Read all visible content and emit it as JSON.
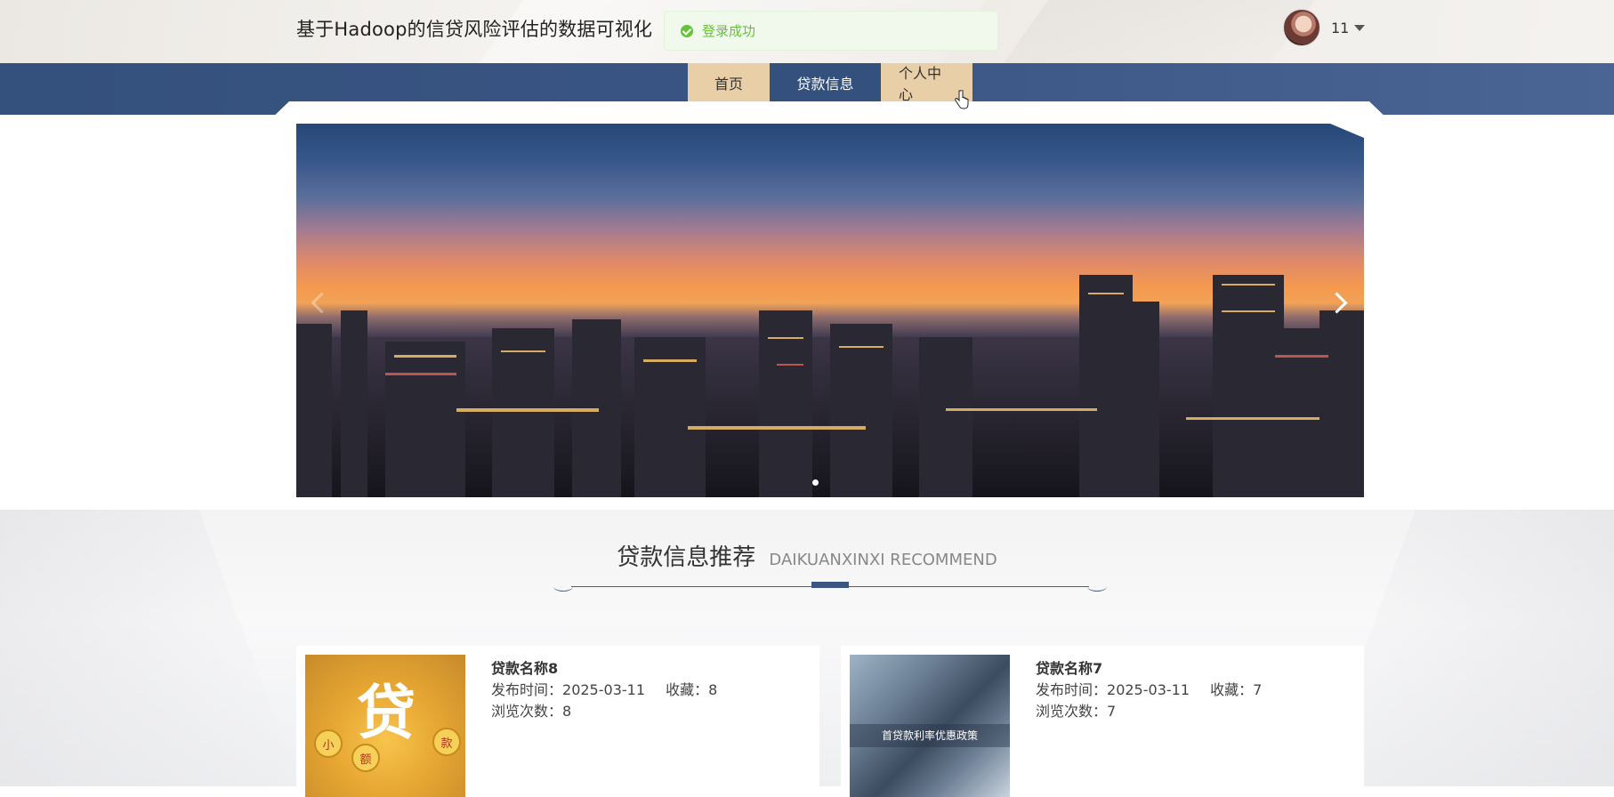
{
  "header": {
    "site_title": "基于Hadoop的信贷风险评估的数据可视化",
    "user_name": "11"
  },
  "toast": {
    "message": "登录成功"
  },
  "nav": {
    "items": [
      {
        "label": "首页"
      },
      {
        "label": "贷款信息"
      },
      {
        "label": "个人中心"
      }
    ]
  },
  "section": {
    "title_cn": "贷款信息推荐",
    "title_en": "DAIKUANXINXI RECOMMEND"
  },
  "cards": [
    {
      "title": "贷款名称8",
      "publish_label": "发布时间：",
      "publish_date": "2025-03-11",
      "fav_label": "收藏：",
      "fav_count": "8",
      "views_label": "浏览次数：",
      "views_count": "8",
      "thumb_chars": {
        "big": "贷",
        "coin1": "小",
        "coin2": "额",
        "coin3": "款"
      }
    },
    {
      "title": "贷款名称7",
      "publish_label": "发布时间：",
      "publish_date": "2025-03-11",
      "fav_label": "收藏：",
      "fav_count": "7",
      "views_label": "浏览次数：",
      "views_count": "7",
      "thumb_caption": "首贷款利率优惠政策"
    }
  ],
  "colors": {
    "nav_bg": "#34507c",
    "nav_active": "#e8cfa7",
    "toast_bg": "#f0f9eb",
    "toast_text": "#67c23a"
  }
}
